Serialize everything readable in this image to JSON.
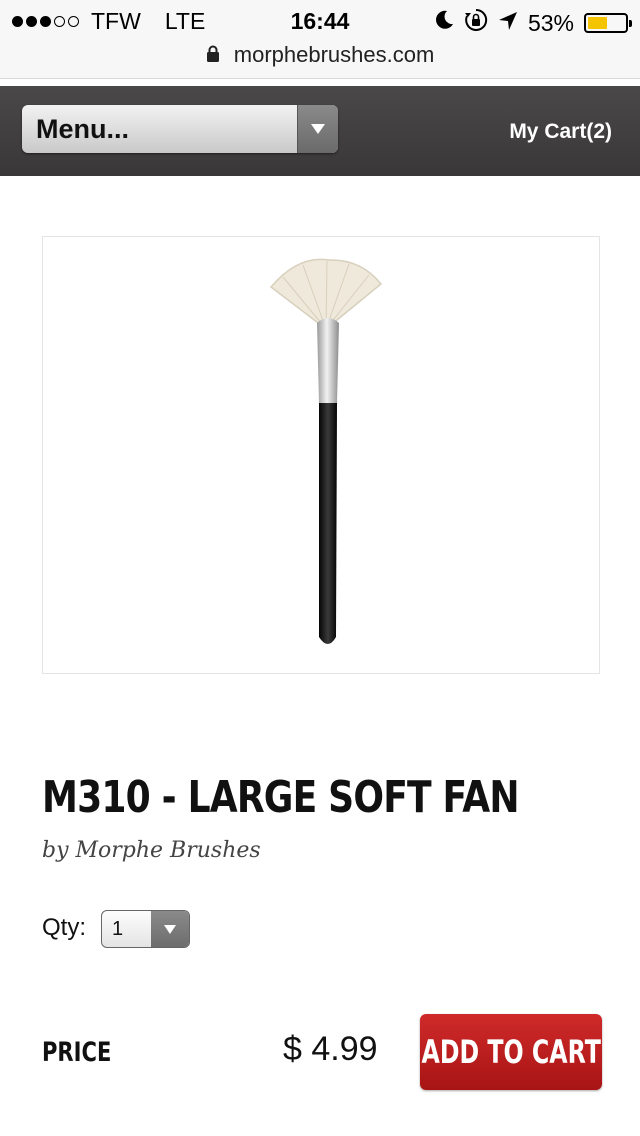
{
  "status_bar": {
    "carrier": "TFW",
    "network": "LTE",
    "time": "16:44",
    "battery": "53%",
    "battery_level": 0.53,
    "signal_bars_filled": 3,
    "signal_bars_total": 5,
    "icons": [
      "moon-icon",
      "rotation-lock-icon",
      "location-arrow-icon",
      "battery-icon"
    ]
  },
  "browser": {
    "url": "morphebrushes.com",
    "secure": true
  },
  "header": {
    "menu_label": "Menu...",
    "cart_label": "My Cart(2)"
  },
  "product": {
    "image": "fan-brush-image",
    "title": "M310 - LARGE SOFT FAN",
    "byline": "by Morphe Brushes",
    "qty_label": "Qty:",
    "qty_value": "1",
    "price_label": "PRICE",
    "price": "$ 4.99",
    "add_to_cart_label": "ADD TO CART"
  },
  "colors": {
    "header_bg": "#403e3e",
    "add_to_cart": "#bd2020",
    "battery_fill": "#f5c400"
  }
}
